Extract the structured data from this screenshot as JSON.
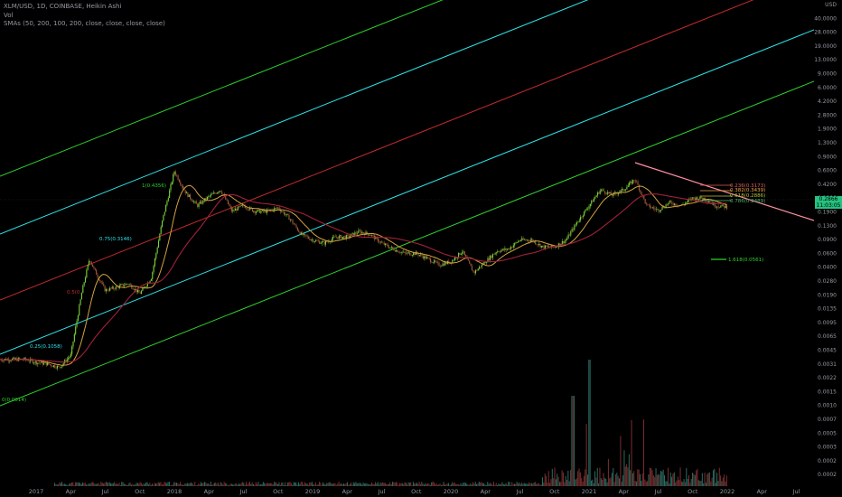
{
  "header": {
    "symbol_line": "XLM/USD, 1D, COINBASE, Heikin Ashi",
    "vol_label": "Vol",
    "smas_label": "SMAs (50, 200, 100, 200, close, close, close, close)"
  },
  "price_badges": {
    "last_price": "0.2866",
    "countdown": "11:03:05"
  },
  "fib_labels": {
    "f0": "0(0.0014)",
    "f025": "0.25(0.1058)",
    "f05": "0.5(0.",
    "f075": "0.75(0.3146)",
    "f1": "1(0.4356)",
    "ext": "1.618(0.0561)",
    "r1": "0.236(0.3173)",
    "r2": "0.382(0.3439)",
    "r3": "0.618(0.2886)",
    "r4": "0.786(0.2489)"
  },
  "chart_data": {
    "type": "candlestick",
    "title": "XLM/USD, 1D, COINBASE, Heikin Ashi",
    "scale": "log",
    "y_unit": "USD",
    "y_ticks": [
      "USD",
      "40.0000",
      "28.0000",
      "19.0000",
      "13.0000",
      "9.0000",
      "6.0000",
      "4.2000",
      "2.8000",
      "1.9000",
      "1.3000",
      "0.9000",
      "0.6000",
      "0.4200",
      "0.2800",
      "0.1900",
      "0.1300",
      "0.0900",
      "0.0600",
      "0.0400",
      "0.0280",
      "0.0190",
      "0.0135",
      "0.0095",
      "0.0065",
      "0.0045",
      "0.0031",
      "0.0022",
      "0.0015",
      "0.0010",
      "0.0007",
      "0.0005",
      "0.0003",
      "0.0002",
      "0.0002"
    ],
    "x_ticks": [
      "2017",
      "Apr",
      "Jul",
      "Oct",
      "2018",
      "Apr",
      "Jul",
      "Oct",
      "2019",
      "Apr",
      "Jul",
      "Oct",
      "2020",
      "Apr",
      "Jul",
      "Oct",
      "2021",
      "Apr",
      "Jul",
      "Oct",
      "2022",
      "Apr",
      "Jul"
    ],
    "price_path": [
      [
        "2016-12",
        0.0022
      ],
      [
        "2017-01",
        0.002
      ],
      [
        "2017-02",
        0.0019
      ],
      [
        "2017-03",
        0.0017
      ],
      [
        "2017-04",
        0.0025
      ],
      [
        "2017-05",
        0.02
      ],
      [
        "2017-05-20",
        0.055
      ],
      [
        "2017-06",
        0.04
      ],
      [
        "2017-07",
        0.02
      ],
      [
        "2017-08",
        0.022
      ],
      [
        "2017-09",
        0.025
      ],
      [
        "2017-10",
        0.018
      ],
      [
        "2017-11",
        0.03
      ],
      [
        "2017-12",
        0.2
      ],
      [
        "2018-01",
        0.9
      ],
      [
        "2018-02",
        0.45
      ],
      [
        "2018-03",
        0.3
      ],
      [
        "2018-04",
        0.4
      ],
      [
        "2018-05",
        0.5
      ],
      [
        "2018-06",
        0.25
      ],
      [
        "2018-07",
        0.3
      ],
      [
        "2018-08",
        0.25
      ],
      [
        "2018-09",
        0.25
      ],
      [
        "2018-10",
        0.28
      ],
      [
        "2018-11",
        0.2
      ],
      [
        "2018-12",
        0.12
      ],
      [
        "2019-01",
        0.1
      ],
      [
        "2019-02",
        0.09
      ],
      [
        "2019-03",
        0.11
      ],
      [
        "2019-04",
        0.11
      ],
      [
        "2019-05",
        0.13
      ],
      [
        "2019-06",
        0.12
      ],
      [
        "2019-07",
        0.09
      ],
      [
        "2019-08",
        0.075
      ],
      [
        "2019-09",
        0.065
      ],
      [
        "2019-10",
        0.065
      ],
      [
        "2019-11",
        0.055
      ],
      [
        "2019-12",
        0.045
      ],
      [
        "2020-01",
        0.05
      ],
      [
        "2020-02",
        0.07
      ],
      [
        "2020-03",
        0.035
      ],
      [
        "2020-04",
        0.05
      ],
      [
        "2020-05",
        0.07
      ],
      [
        "2020-06",
        0.075
      ],
      [
        "2020-07",
        0.1
      ],
      [
        "2020-08",
        0.1
      ],
      [
        "2020-09",
        0.08
      ],
      [
        "2020-10",
        0.08
      ],
      [
        "2020-11",
        0.1
      ],
      [
        "2020-12",
        0.18
      ],
      [
        "2021-01",
        0.3
      ],
      [
        "2021-02",
        0.5
      ],
      [
        "2021-03",
        0.42
      ],
      [
        "2021-04",
        0.5
      ],
      [
        "2021-05",
        0.7
      ],
      [
        "2021-06",
        0.3
      ],
      [
        "2021-07",
        0.26
      ],
      [
        "2021-08",
        0.33
      ],
      [
        "2021-09",
        0.3
      ],
      [
        "2021-10",
        0.38
      ],
      [
        "2021-11",
        0.38
      ],
      [
        "2021-12",
        0.3
      ],
      [
        "2022-01",
        0.2866
      ]
    ],
    "sma_series": [
      {
        "name": "SMA 50",
        "color": "#d4a341"
      },
      {
        "name": "SMA 200",
        "color": "#a3213a"
      }
    ],
    "fib_channel": {
      "levels": [
        {
          "level": 0,
          "value": 0.0014,
          "color": "#2ed12e"
        },
        {
          "level": 0.25,
          "value": 0.1058,
          "color": "#2ee5ea"
        },
        {
          "level": 0.5,
          "color": "#c42b2b"
        },
        {
          "level": 0.75,
          "value": 0.3146,
          "color": "#2ee5ea"
        },
        {
          "level": 1,
          "value": 0.4356,
          "color": "#2ed12e"
        }
      ]
    },
    "fib_retracement": [
      {
        "level": 0.236,
        "value": 0.3173
      },
      {
        "level": 0.382,
        "value": 0.3439
      },
      {
        "level": 0.618,
        "value": 0.2886
      },
      {
        "level": 0.786,
        "value": 0.2489
      }
    ],
    "fib_extension": {
      "level": 1.618,
      "value": 0.0561
    },
    "last_price": 0.2866,
    "colors": {
      "up": "#26a69a",
      "down": "#ef5350",
      "bg": "#000000",
      "grid": "#1e222d"
    }
  }
}
